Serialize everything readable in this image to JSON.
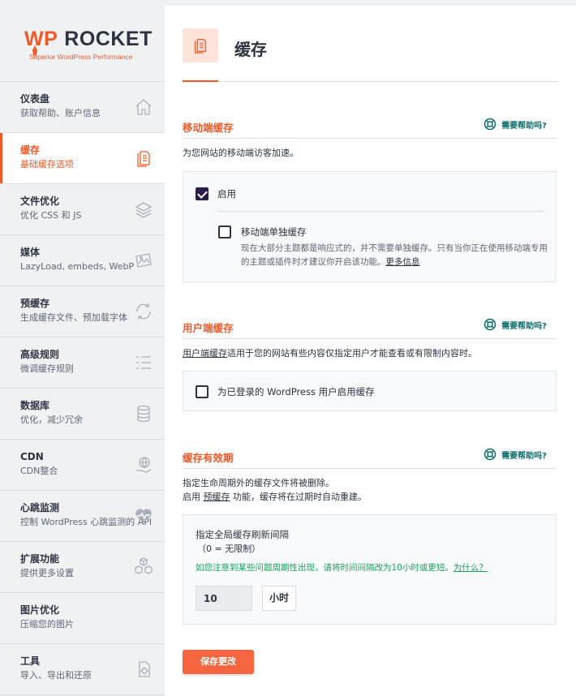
{
  "brand": {
    "wp": "WP",
    "rocket": "ROCKET",
    "tagline": "Superior WordPress Performance"
  },
  "sidebar": {
    "items": [
      {
        "title": "仪表盘",
        "sub": "获取帮助、账户信息",
        "icon": "home-icon"
      },
      {
        "title": "缓存",
        "sub": "基础缓存选项",
        "icon": "document-icon",
        "active": true
      },
      {
        "title": "文件优化",
        "sub": "优化 CSS 和 JS",
        "icon": "layers-icon"
      },
      {
        "title": "媒体",
        "sub": "LazyLoad, embeds, WebP",
        "icon": "image-icon"
      },
      {
        "title": "预缓存",
        "sub": "生成缓存文件、预加载字体",
        "icon": "refresh-icon"
      },
      {
        "title": "高级规则",
        "sub": "微调缓存规则",
        "icon": "list-icon"
      },
      {
        "title": "数据库",
        "sub": "优化，减少冗余",
        "icon": "database-icon"
      },
      {
        "title": "CDN",
        "sub": "CDN整合",
        "icon": "globe-hand-icon"
      },
      {
        "title": "心跳监测",
        "sub": "控制 WordPress 心跳监测的 API",
        "icon": "heartbeat-icon"
      },
      {
        "title": "扩展功能",
        "sub": "提供更多设置",
        "icon": "boxes-icon"
      },
      {
        "title": "图片优化",
        "sub": "压缩您的图片",
        "icon": ""
      },
      {
        "title": "工具",
        "sub": "导入、导出和还原",
        "icon": "tools-icon"
      }
    ]
  },
  "page": {
    "title": "缓存"
  },
  "mobile": {
    "title": "移动端缓存",
    "help": "需要帮助吗?",
    "desc": "为您网站的移动端访客加速。",
    "enable_label": "启用",
    "enable_checked": true,
    "separate_label": "移动端单独缓存",
    "separate_checked": false,
    "separate_desc": "现在大部分主题都是响应式的，并不需要单独缓存。只有当你正在使用移动端专用的主题或插件时才建议你开启该功能。",
    "more_info": "更多信息"
  },
  "user": {
    "title": "用户端缓存",
    "help": "需要帮助吗?",
    "desc_link": "用户端缓存",
    "desc_rest": "适用于您的网站有些内容仅指定用户才能查看或有限制内容时。",
    "enable_label": "为已登录的 WordPress 用户启用缓存",
    "enable_checked": false
  },
  "lifespan": {
    "title": "缓存有效期",
    "help": "需要帮助吗?",
    "desc1": "指定生命周期外的缓存文件将被删除。",
    "desc2_a": "启用 ",
    "desc2_link": "预缓存",
    "desc2_b": " 功能，缓存将在过期时自动重建。",
    "field_label": "指定全局缓存刷新间隔",
    "field_hint": "（0 = 无限制）",
    "warning": "如您注意到某些问题周期性出现，请将时间间隔改为10小时或更短。",
    "warning_link": "为什么？",
    "value": "10",
    "unit": "小时"
  },
  "save_label": "保存更改",
  "colors": {
    "accent": "#f05a28",
    "teal": "#0e6e6b",
    "green": "#1ba35e"
  }
}
